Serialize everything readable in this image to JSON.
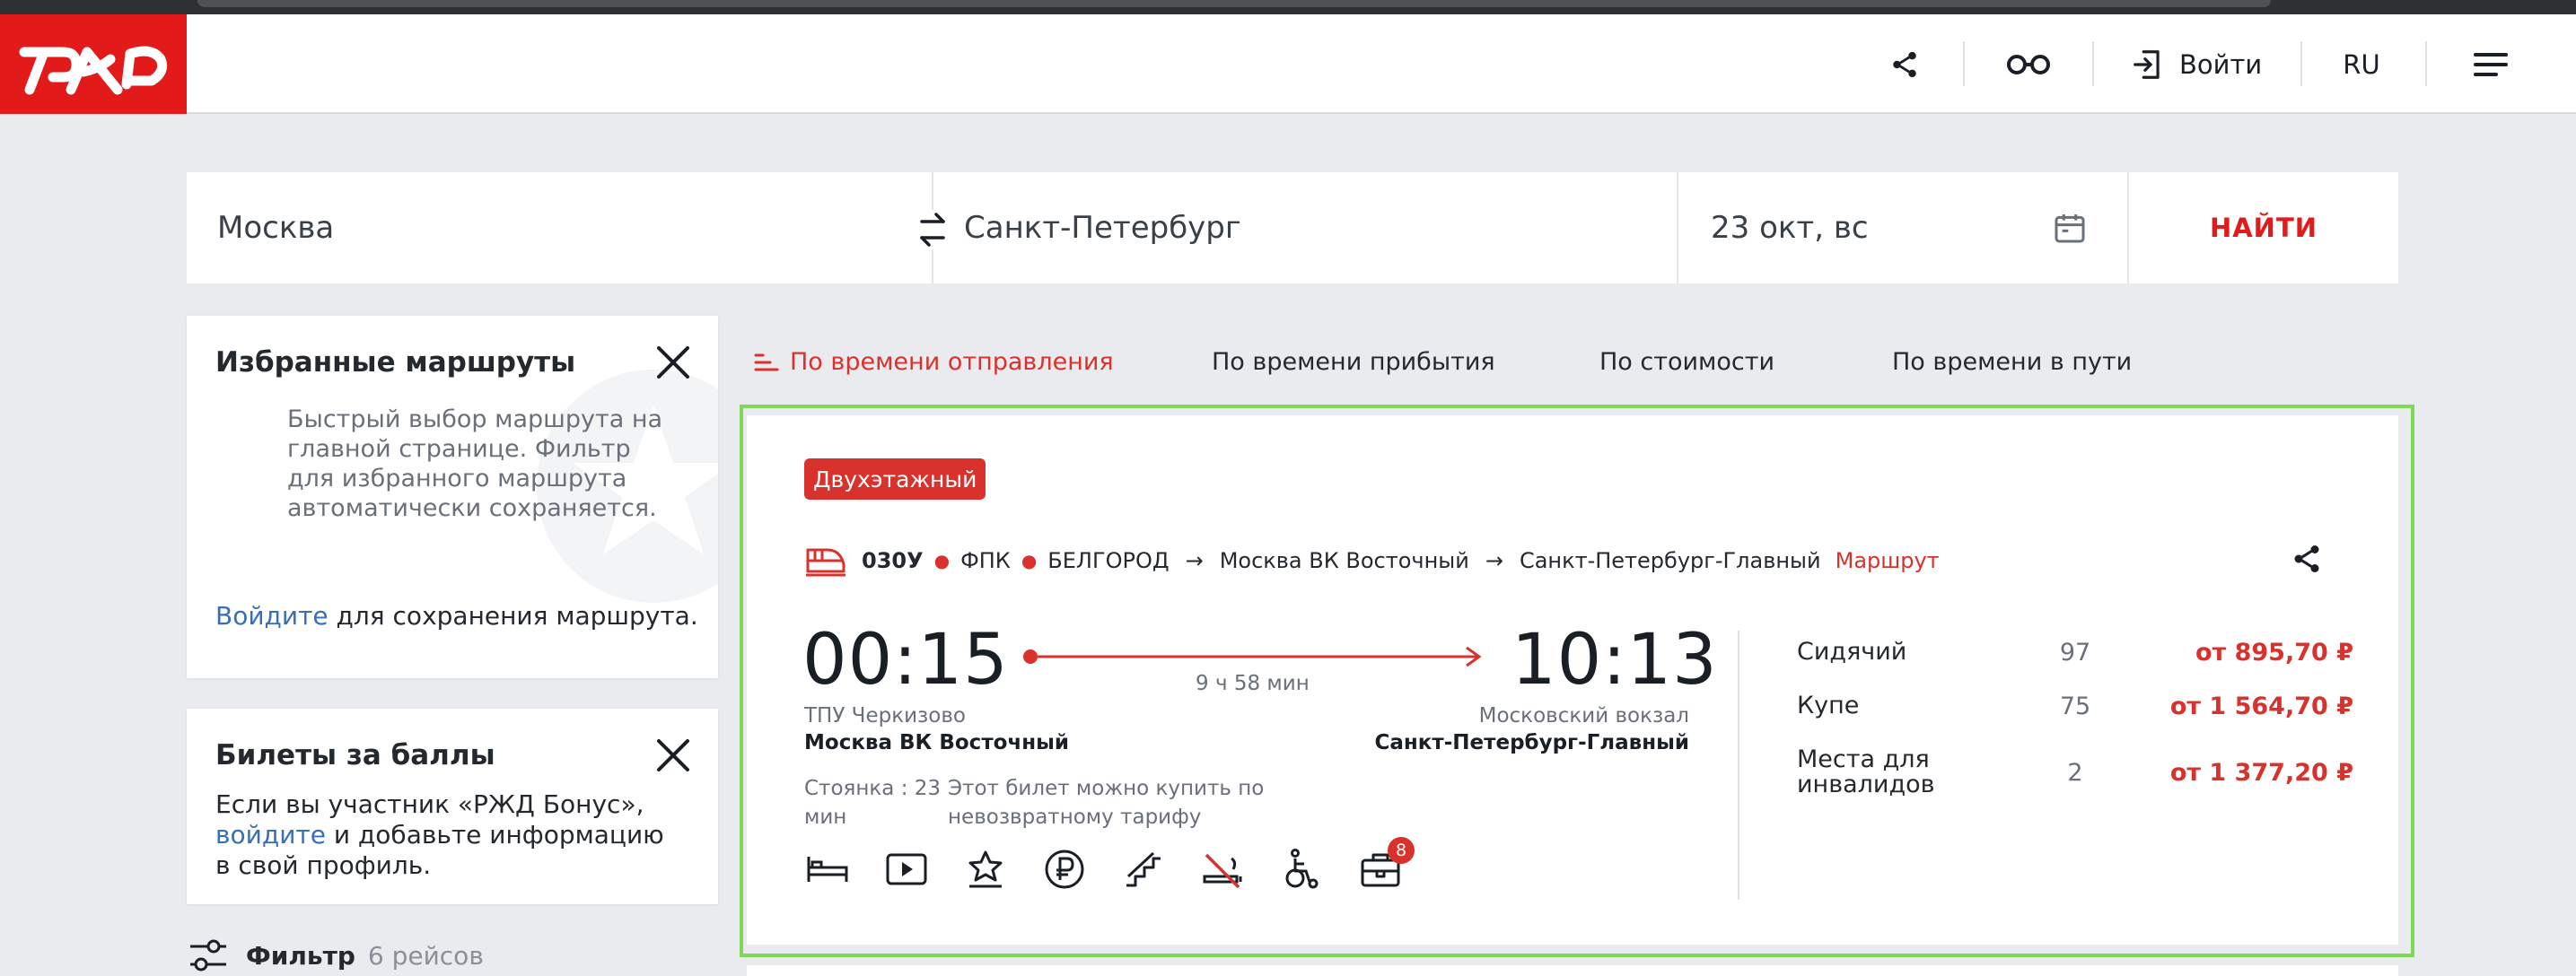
{
  "header": {
    "login_label": "Войти",
    "lang_label": "RU"
  },
  "search": {
    "from": "Москва",
    "to": "Санкт-Петербург",
    "date": "23 окт, вс",
    "find_label": "НАЙТИ"
  },
  "favorites": {
    "title": "Избранные маршруты",
    "description": "Быстрый выбор маршрута на главной странице. Фильтр для избранного маршрута автоматически сохраняется.",
    "login_link": "Войдите",
    "login_suffix": " для сохранения маршрута."
  },
  "bonus": {
    "title": "Билеты за баллы",
    "text_before": "Если вы участник «РЖД Бонус», ",
    "link": "войдите",
    "text_after": " и добавьте информацию в свой профиль."
  },
  "filter": {
    "label": "Фильтр",
    "count": "6 рейсов"
  },
  "sort_tabs": [
    {
      "label": "По времени отправления",
      "active": true
    },
    {
      "label": "По времени прибытия",
      "active": false
    },
    {
      "label": "По стоимости",
      "active": false
    },
    {
      "label": "По времени в пути",
      "active": false
    }
  ],
  "train": {
    "badge": "Двухэтажный",
    "number": "030У",
    "carrier": "ФПК",
    "brand": "БЕЛГОРОД",
    "from_station": "Москва ВК Восточный",
    "to_station": "Санкт-Петербург-Главный",
    "route_link": "Маршрут",
    "depart_time": "00:15",
    "arrive_time": "10:13",
    "duration": "9 ч 58 мин",
    "depart_hub": "ТПУ Черкизово",
    "depart_station": "Москва ВК Восточный",
    "arrive_hub": "Московский вокзал",
    "arrive_station": "Санкт-Петербург-Главный",
    "stop_line1": "Стоянка : 23",
    "stop_line2": "мин",
    "nonrefund_line1": "Этот билет можно купить по",
    "nonrefund_line2": "невозвратному тарифу",
    "amenities": [
      "bed-icon",
      "video-icon",
      "award-icon",
      "ruble-icon",
      "stairs-icon",
      "no-smoking-icon",
      "wheelchair-icon",
      "luggage-icon"
    ],
    "luggage_count": "8",
    "classes": [
      {
        "name": "Сидячий",
        "seats": "97",
        "price": "от 895,70 ₽"
      },
      {
        "name": "Купе",
        "seats": "75",
        "price": "от 1 564,70 ₽"
      },
      {
        "name": "Места для инвалидов",
        "seats": "2",
        "price": "от 1 377,20 ₽"
      }
    ]
  },
  "colors": {
    "brand_red": "#e21a1a",
    "accent_red": "#d9322c",
    "link_blue": "#3a6fb7",
    "highlight_green": "#7ed957"
  }
}
